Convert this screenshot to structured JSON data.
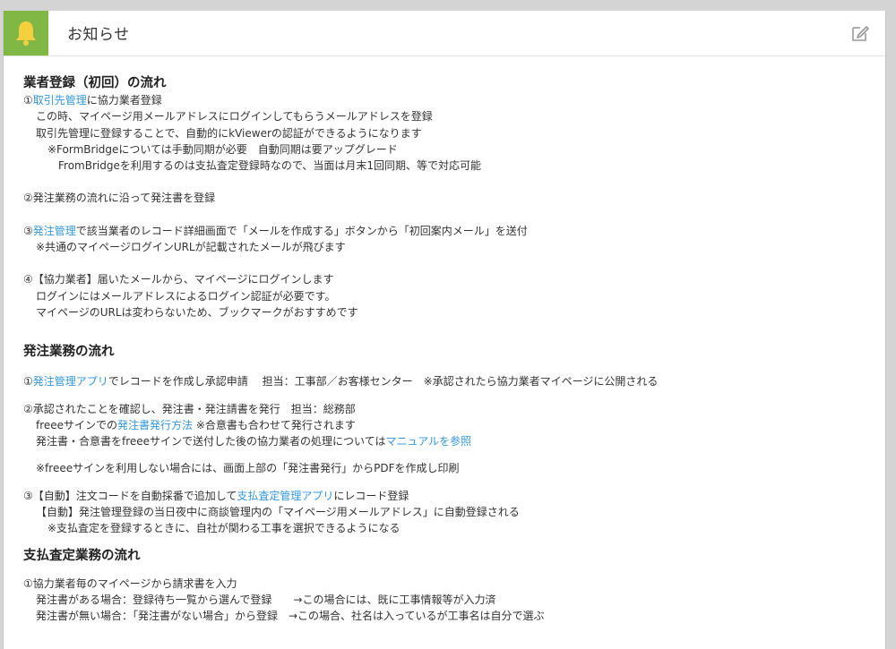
{
  "header": {
    "title": "お知らせ",
    "bell_icon": "bell-icon",
    "edit_icon": "edit-icon",
    "accent_color": "#81b744"
  },
  "sections": {
    "s1": {
      "title": "業者登録（初回）の流れ",
      "l1_pre": "①",
      "l1_link": "取引先管理",
      "l1_post": "に協力業者登録",
      "l2": "この時、マイページ用メールアドレスにログインしてもらうメールアドレスを登録",
      "l3": "取引先管理に登録することで、自動的にkViewerの認証ができるようになります",
      "l4": "※FormBridgeについては手動同期が必要　自動同期は要アップグレード",
      "l5": "FromBridgeを利用するのは支払査定登録時なので、当面は月末1回同期、等で対応可能",
      "l6": "②発注業務の流れに沿って発注書を登録",
      "l7_pre": "③",
      "l7_link": "発注管理",
      "l7_post": "で該当業者のレコード詳細画面で「メールを作成する」ボタンから「初回案内メール」を送付",
      "l8": "※共通のマイページログインURLが記載されたメールが飛びます",
      "l9": "④【協力業者】届いたメールから、マイページにログインします",
      "l10": "ログインにはメールアドレスによるログイン認証が必要です。",
      "l11": "マイページのURLは変わらないため、ブックマークがおすすめです"
    },
    "s2": {
      "title": "発注業務の流れ",
      "l1_pre": "①",
      "l1_link": "発注管理アプリ",
      "l1_post": "でレコードを作成し承認申請　 担当：工事部／お客様センター　※承認されたら協力業者マイページに公開される",
      "l2": "②承認されたことを確認し、発注書・発注請書を発行　担当：総務部",
      "l3_pre": "freeeサインでの",
      "l3_link": "発注書発行方法",
      "l3_post": " ※合意書も合わせて発行されます",
      "l4_pre": "発注書・合意書をfreeeサインで送付した後の協力業者の処理については",
      "l4_link": "マニュアルを参照",
      "l5": "※freeeサインを利用しない場合には、画面上部の「発注書発行」からPDFを作成し印刷",
      "l6_pre": "③【自動】注文コードを自動採番で追加して",
      "l6_link": "支払査定管理アプリ",
      "l6_post": "にレコード登録",
      "l7": "【自動】発注管理登録の当日夜中に商談管理内の「マイページ用メールアドレス」に自動登録される",
      "l8": "※支払査定を登録するときに、自社が関わる工事を選択できるようになる"
    },
    "s3": {
      "title": "支払査定業務の流れ",
      "l1": "①協力業者毎のマイページから請求書を入力",
      "l2": "発注書がある場合：登録待ち一覧から選んで登録　　→この場合には、既に工事情報等が入力済",
      "l3": "発注書が無い場合：「発注書がない場合」から登録　→この場合、社名は入っているが工事名は自分で選ぶ"
    }
  }
}
